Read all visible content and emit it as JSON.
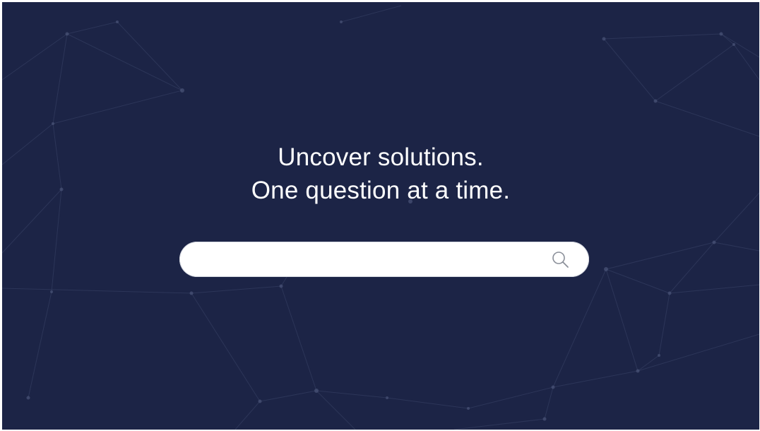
{
  "hero": {
    "headline_line1": "Uncover solutions.",
    "headline_line2": "One question at a time."
  },
  "search": {
    "value": "",
    "placeholder": "",
    "icon": "search-icon"
  },
  "colors": {
    "background": "#1c2446",
    "text": "#ffffff",
    "search_bg": "#ffffff",
    "icon": "#8a8f99"
  }
}
